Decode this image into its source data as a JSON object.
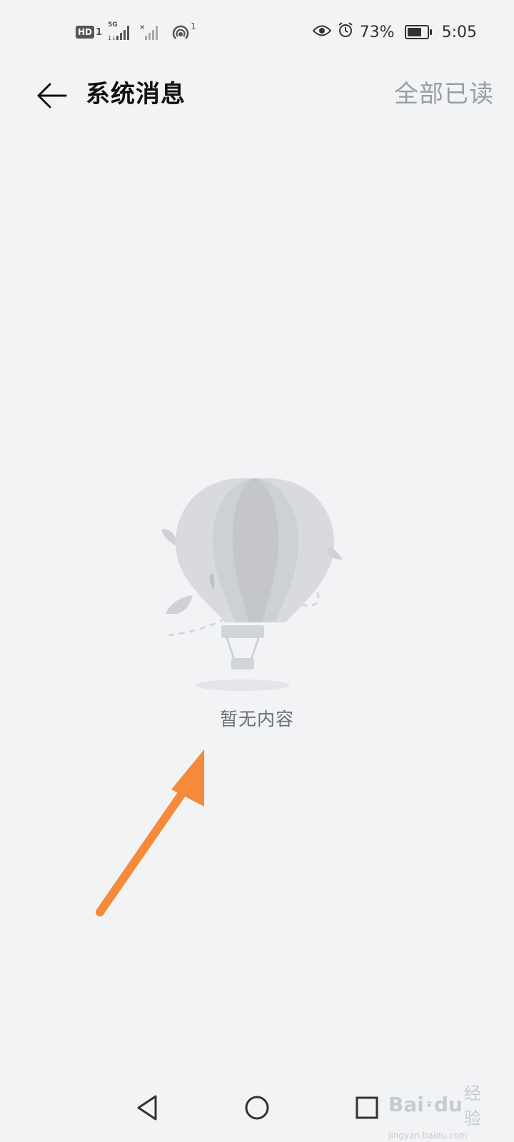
{
  "status_bar": {
    "hd_label": "HD",
    "hd_sim": "1",
    "network_label": "5G",
    "hotspot_count": "1",
    "battery_percent": "73%",
    "battery_level": 0.73,
    "time": "5:05"
  },
  "header": {
    "title": "系统消息",
    "mark_all_read": "全部已读"
  },
  "empty_state": {
    "text": "暂无内容"
  },
  "colors": {
    "background": "#f1f3f5",
    "annotation_arrow": "#f58a3a",
    "balloon_light": "#d8dade",
    "balloon_dark": "#c4c6cc"
  },
  "watermark": {
    "logo_text_left": "Bai",
    "logo_text_right": "du",
    "service": "经验",
    "url": "jingyan.baidu.com"
  }
}
